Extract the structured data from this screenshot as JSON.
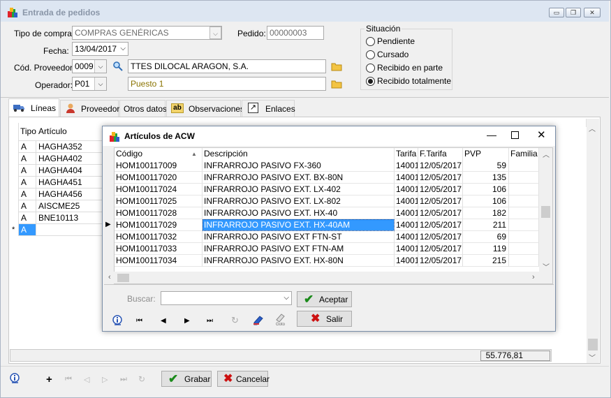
{
  "window": {
    "title": "Entrada de pedidos",
    "minimize": "▭",
    "restore": "❐",
    "close": "✕"
  },
  "header": {
    "tipo_compra_label": "Tipo de compra:",
    "tipo_compra_value": "COMPRAS GENÉRICAS",
    "pedido_label": "Pedido:",
    "pedido_value": "00000003",
    "fecha_label": "Fecha:",
    "fecha_value": "13/04/2017",
    "proveedor_label": "Cód. Proveedor:",
    "proveedor_code": "0009",
    "proveedor_name": "TTES DILOCAL ARAGON, S.A.",
    "operador_label": "Operador:",
    "operador_code": "P01",
    "operador_name": "Puesto 1"
  },
  "situacion": {
    "legend": "Situación",
    "options": [
      {
        "label": "Pendiente",
        "selected": false
      },
      {
        "label": "Cursado",
        "selected": false
      },
      {
        "label": "Recibido en parte",
        "selected": false
      },
      {
        "label": "Recibido totalmente",
        "selected": true
      }
    ]
  },
  "tabs": [
    {
      "label": "Líneas",
      "icon": "truck-icon"
    },
    {
      "label": "Proveedor",
      "icon": "person-icon"
    },
    {
      "label": "Otros datos",
      "icon": ""
    },
    {
      "label": "Observaciones",
      "icon": "ab-icon"
    },
    {
      "label": "Enlaces",
      "icon": "link-icon"
    }
  ],
  "lines_grid": {
    "columns": [
      "Tipo",
      "Artículo"
    ],
    "rows": [
      {
        "tipo": "A",
        "articulo": "HAGHA352"
      },
      {
        "tipo": "A",
        "articulo": "HAGHA402"
      },
      {
        "tipo": "A",
        "articulo": "HAGHA404"
      },
      {
        "tipo": "A",
        "articulo": "HAGHA451"
      },
      {
        "tipo": "A",
        "articulo": "HAGHA456"
      },
      {
        "tipo": "A",
        "articulo": "AISCME25"
      },
      {
        "tipo": "A",
        "articulo": "BNE10113"
      }
    ],
    "new_row_marker": "*",
    "new_row_tipo": "A",
    "total": "55.776,81"
  },
  "footer": {
    "add": "+",
    "save_label": "Grabar",
    "cancel_label": "Cancelar"
  },
  "dialog": {
    "title": "Artículos de ACW",
    "columns": [
      "Código",
      "Descripción",
      "Tarifa",
      "F.Tarifa",
      "PVP",
      "Familia"
    ],
    "rows": [
      {
        "codigo": "HOM100117009",
        "descripcion": "INFRARROJO PASIVO FX-360",
        "tarifa": "14001",
        "ftarifa": "12/05/2017",
        "pvp": "59"
      },
      {
        "codigo": "HOM100117020",
        "descripcion": "INFRARROJO PASIVO EXT. BX-80N",
        "tarifa": "14001",
        "ftarifa": "12/05/2017",
        "pvp": "135"
      },
      {
        "codigo": "HOM100117024",
        "descripcion": "INFRARROJO PASIVO EXT. LX-402",
        "tarifa": "14001",
        "ftarifa": "12/05/2017",
        "pvp": "106"
      },
      {
        "codigo": "HOM100117025",
        "descripcion": "INFRARROJO PASIVO EXT. LX-802",
        "tarifa": "14001",
        "ftarifa": "12/05/2017",
        "pvp": "106"
      },
      {
        "codigo": "HOM100117028",
        "descripcion": "INFRARROJO PASIVO EXT. HX-40",
        "tarifa": "14001",
        "ftarifa": "12/05/2017",
        "pvp": "182"
      },
      {
        "codigo": "HOM100117029",
        "descripcion": "INFRARROJO PASIVO EXT. HX-40AM",
        "tarifa": "14001",
        "ftarifa": "12/05/2017",
        "pvp": "211",
        "selected": true
      },
      {
        "codigo": "HOM100117032",
        "descripcion": "INFRARROJO PASIVO EXT FTN-ST",
        "tarifa": "14001",
        "ftarifa": "12/05/2017",
        "pvp": "69"
      },
      {
        "codigo": "HOM100117033",
        "descripcion": "INFRARROJO PASIVO EXT FTN-AM",
        "tarifa": "14001",
        "ftarifa": "12/05/2017",
        "pvp": "119"
      },
      {
        "codigo": "HOM100117034",
        "descripcion": "INFRARROJO PASIVO EXT. HX-80N",
        "tarifa": "14001",
        "ftarifa": "12/05/2017",
        "pvp": "215"
      }
    ],
    "search_label": "Buscar:",
    "search_value": "",
    "accept_label": "Aceptar",
    "exit_label": "Salir",
    "goto_label": "Goto"
  },
  "colors": {
    "selection": "#3399ff",
    "accent": "#0078d7",
    "ok_green": "#1a8a1a",
    "cancel_red": "#cc1111"
  }
}
